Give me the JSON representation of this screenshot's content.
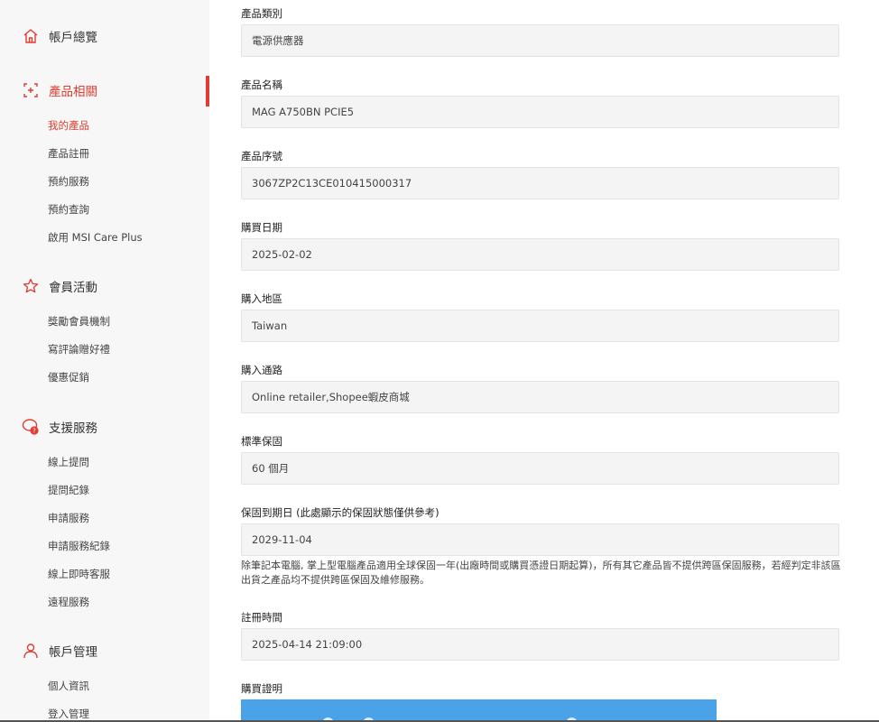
{
  "sidebar": {
    "sections": [
      {
        "label": "帳戶總覽",
        "icon": "home-icon",
        "items": []
      },
      {
        "label": "產品相關",
        "icon": "product-icon",
        "items": [
          "我的產品",
          "產品註冊",
          "預約服務",
          "預約查詢",
          "啟用 MSI Care Plus"
        ]
      },
      {
        "label": "會員活動",
        "icon": "star-icon",
        "items": [
          "獎勵會員機制",
          "寫評論贈好禮",
          "優惠促銷"
        ]
      },
      {
        "label": "支援服務",
        "icon": "support-chat-icon",
        "items": [
          "線上提問",
          "提問紀錄",
          "申請服務",
          "申請服務紀錄",
          "線上即時客服",
          "遠程服務"
        ]
      },
      {
        "label": "帳戶管理",
        "icon": "user-icon",
        "items": [
          "個人資訊",
          "登入管理"
        ]
      }
    ],
    "accent_color": "#e03c31"
  },
  "form": {
    "fields": [
      {
        "label": "產品類別",
        "value": "電源供應器"
      },
      {
        "label": "產品名稱",
        "value": "MAG A750BN PCIE5"
      },
      {
        "label": "產品序號",
        "value": "3067ZP2C13CE010415000317"
      },
      {
        "label": "購買日期",
        "value": "2025-02-02"
      },
      {
        "label": "購入地區",
        "value": "Taiwan"
      },
      {
        "label": "購入通路",
        "value": "Online retailer,Shopee蝦皮商城"
      },
      {
        "label": "標準保固",
        "value": "60 個月"
      },
      {
        "label": "保固到期日 (此處顯示的保固狀態僅供參考)",
        "value": "2029-11-04"
      },
      {
        "label": "註冊時間",
        "value": "2025-04-14 21:09:00"
      }
    ],
    "warranty_note": "除筆記本電腦, 掌上型電腦產品適用全球保固一年(出廠時間或購買憑證日期起算)，所有其它產品皆不提供跨區保固服務，若經判定非該區出貨之產品均不提供跨區保固及維修服務。",
    "receipt_label": "購買證明"
  }
}
